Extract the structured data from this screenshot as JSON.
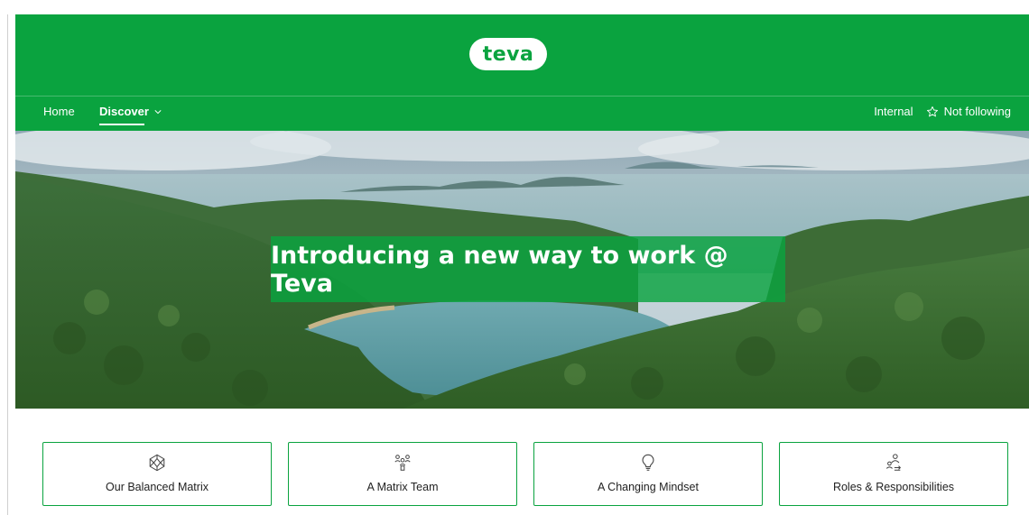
{
  "brand": {
    "logo_text": "teva",
    "color": "#0aa33f"
  },
  "nav": {
    "home": "Home",
    "discover": "Discover",
    "internal": "Internal",
    "follow": "Not following"
  },
  "hero": {
    "title": "Introducing a new way to work @ Teva"
  },
  "cards": [
    {
      "label": "Our Balanced Matrix",
      "icon": "network-icon"
    },
    {
      "label": "A Matrix Team",
      "icon": "team-icon"
    },
    {
      "label": "A Changing Mindset",
      "icon": "lightbulb-icon"
    },
    {
      "label": "Roles & Responsibilities",
      "icon": "people-swap-icon"
    }
  ]
}
